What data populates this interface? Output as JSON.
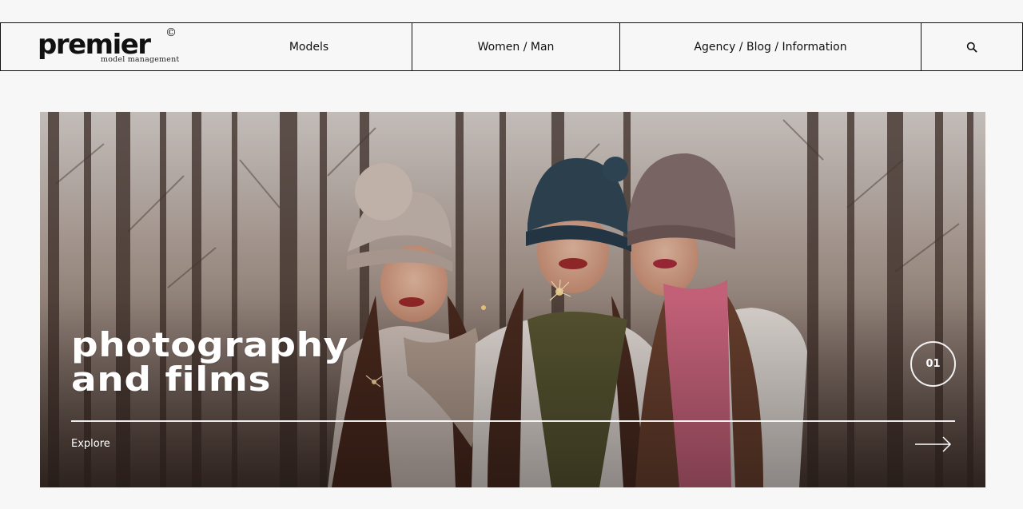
{
  "header": {
    "logo": {
      "word": "premier",
      "copyright_mark": "©",
      "tagline": "model management"
    },
    "nav": [
      {
        "label": "Models"
      },
      {
        "label": "Women / Man"
      },
      {
        "label": "Agency / Blog / Information"
      }
    ],
    "search_icon": "search-icon"
  },
  "hero": {
    "title_line1": "photography",
    "title_line2": "and films",
    "counter": "01",
    "cta_label": "Explore",
    "cta_icon": "arrow-right-icon",
    "photo_description_icon": "hero-photo"
  },
  "colors": {
    "background": "#f7f7f7",
    "text": "#111111",
    "hero_text": "#ffffff"
  }
}
